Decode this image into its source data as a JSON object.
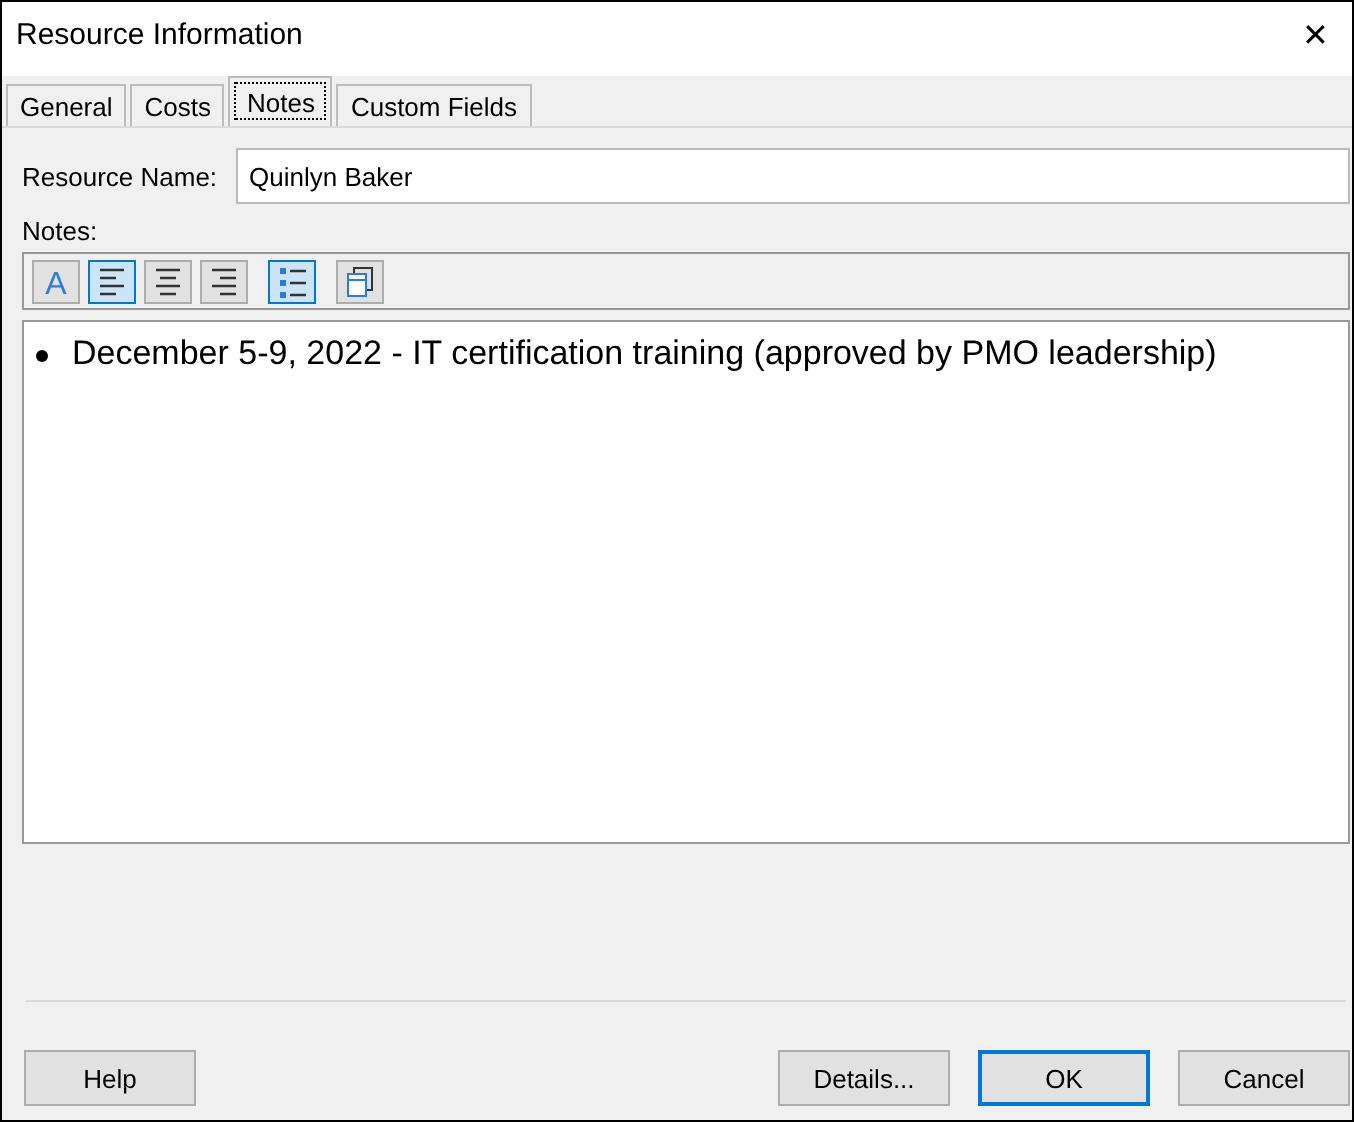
{
  "window": {
    "title": "Resource Information",
    "close": "✕"
  },
  "tabs": [
    {
      "label": "General",
      "selected": false
    },
    {
      "label": "Costs",
      "selected": false
    },
    {
      "label": "Notes",
      "selected": true
    },
    {
      "label": "Custom Fields",
      "selected": false
    }
  ],
  "resource_name": {
    "label": "Resource Name:",
    "value": "Quinlyn Baker"
  },
  "notes": {
    "label": "Notes:",
    "toolbar": [
      {
        "kind": "font",
        "text": "A",
        "selected": false
      },
      {
        "kind": "align-left",
        "selected": true
      },
      {
        "kind": "align-center",
        "selected": false
      },
      {
        "kind": "align-right",
        "selected": false
      },
      {
        "kind": "bullets",
        "selected": true
      },
      {
        "kind": "object",
        "selected": false
      }
    ],
    "bullets": [
      "December 5-9, 2022 - IT certification training (approved by PMO leadership)"
    ]
  },
  "buttons": [
    {
      "label": "Help",
      "default": false
    },
    {
      "label": "Details...",
      "default": false
    },
    {
      "label": "OK",
      "default": true
    },
    {
      "label": "Cancel",
      "default": false
    }
  ]
}
